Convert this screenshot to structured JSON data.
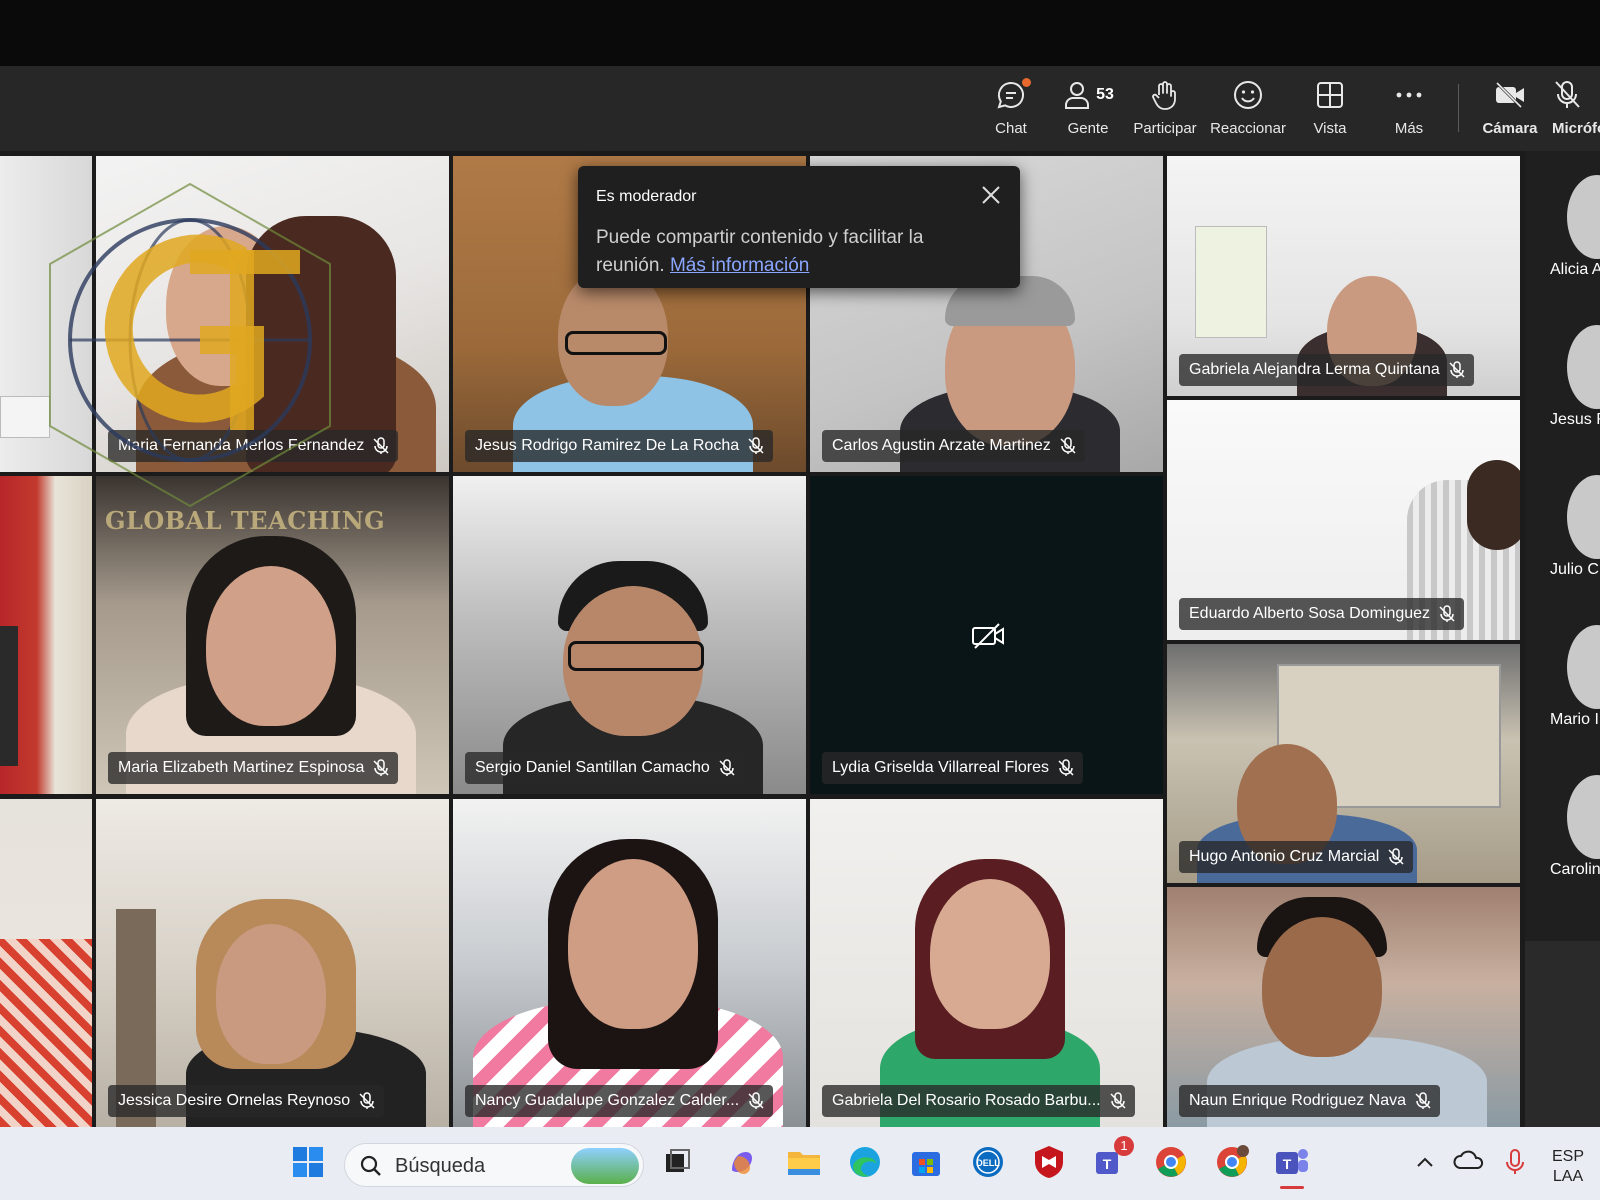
{
  "toolbar": {
    "chat": "Chat",
    "people_count": "53",
    "people": "Gente",
    "raise": "Participar",
    "react": "Reaccionar",
    "view": "Vista",
    "more": "Más",
    "camera": "Cámara",
    "mic": "Micrófono"
  },
  "tooltip": {
    "title": "Es moderador",
    "body": "Puede compartir contenido y facilitar la reunión.",
    "link": "Más información"
  },
  "watermark": "GLOBAL TEACHING",
  "participants": [
    "Maria Fernanda Merlos Fernandez",
    "Jesus Rodrigo Ramirez De La Rocha",
    "Carlos Agustin Arzate Martinez",
    "Gabriela Alejandra Lerma Quintana",
    "Maria Elizabeth Martinez Espinosa",
    "Sergio Daniel Santillan Camacho",
    "Lydia Griselda Villarreal Flores",
    "Eduardo Alberto Sosa Dominguez",
    "Hugo Antonio Cruz Marcial",
    "Jessica Desire Ornelas Reynoso",
    "Nancy Guadalupe Gonzalez Calder...",
    "Gabriela Del Rosario Rosado Barbu...",
    "Naun Enrique Rodriguez Nava"
  ],
  "rail": [
    "Alicia A",
    "Jesus R",
    "Julio C",
    "Mario I",
    "Carolin"
  ],
  "taskbar": {
    "search_placeholder": "Búsqueda",
    "lang_line1": "ESP",
    "lang_line2": "LAA",
    "teams_badge": "1"
  },
  "colors": {
    "accent_link": "#8aa6ff",
    "toolbar_bg": "#272727",
    "notification_dot": "#e8692e"
  }
}
